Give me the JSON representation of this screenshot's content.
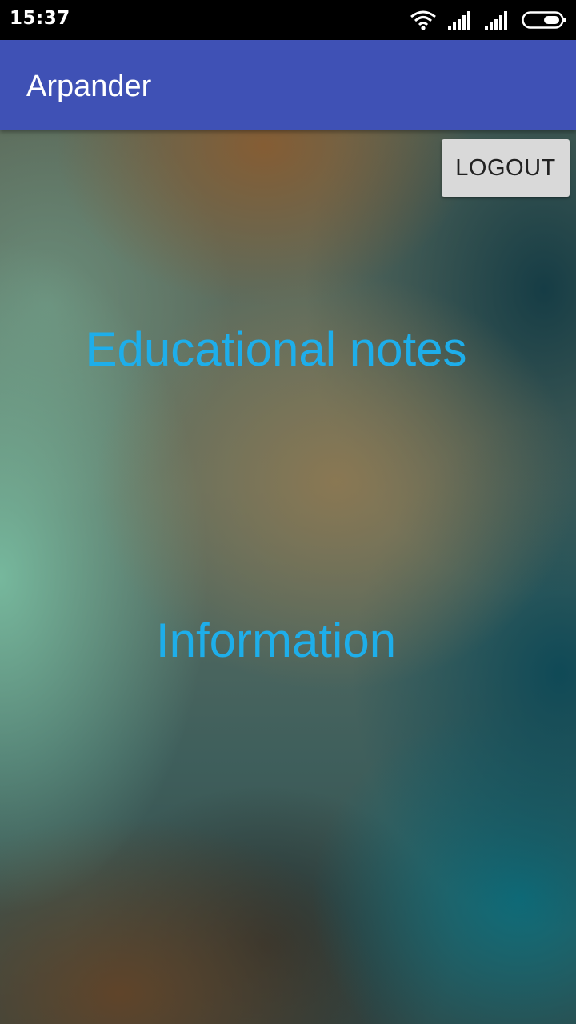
{
  "status_bar": {
    "time": "15:37",
    "icons": [
      "wifi-icon",
      "signal-icon",
      "signal-icon",
      "battery-icon"
    ]
  },
  "app_bar": {
    "title": "Arpander",
    "color": "#3f51b5"
  },
  "content": {
    "logout_label": "LOGOUT",
    "links": {
      "educational_notes": "Educational notes",
      "information": "Information"
    },
    "link_color": "#1eaeea"
  }
}
